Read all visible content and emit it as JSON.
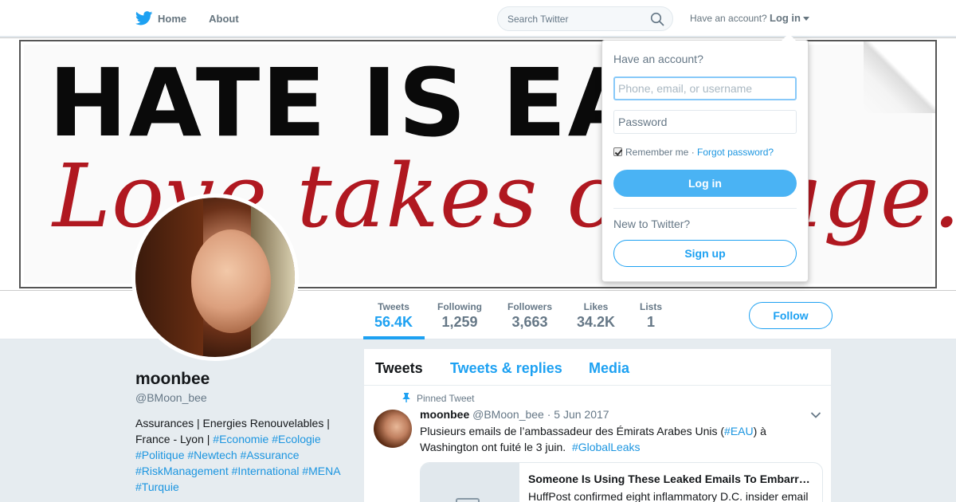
{
  "nav": {
    "home_label": "Home",
    "about_label": "About",
    "search_placeholder": "Search Twitter",
    "have_account": "Have an account?",
    "login_label": "Log in"
  },
  "banner": {
    "line1": "HATE IS EASY",
    "line2": "Love takes courage."
  },
  "profile": {
    "name": "moonbee",
    "handle": "@BMoon_bee",
    "bio_text": "Assurances | Energies Renouvelables | France - Lyon |",
    "bio_tags": [
      "#Economie",
      "#Ecologie",
      "#Politique",
      "#Newtech",
      "#Assurance",
      "#RiskManagement",
      "#International",
      "#MENA",
      "#Turquie"
    ]
  },
  "stats": [
    {
      "label": "Tweets",
      "value": "56.4K"
    },
    {
      "label": "Following",
      "value": "1,259"
    },
    {
      "label": "Followers",
      "value": "3,663"
    },
    {
      "label": "Likes",
      "value": "34.2K"
    },
    {
      "label": "Lists",
      "value": "1"
    }
  ],
  "follow_label": "Follow",
  "timeline": {
    "tabs": [
      "Tweets",
      "Tweets & replies",
      "Media"
    ],
    "pinned_label": "Pinned Tweet",
    "tweet": {
      "name": "moonbee",
      "handle": "@BMoon_bee",
      "dot": "·",
      "date": "5 Jun 2017",
      "text_before": "Plusieurs emails de l’ambassadeur des Émirats Arabes Unis (",
      "tag1": "#EAU",
      "text_mid": ") à Washington ont fuité le 3 juin.",
      "tag2": "#GlobalLeaks",
      "card_title": "Someone Is Using These Leaked Emails To Embarrass Washington's Most Powerful Ambassador",
      "card_desc": "HuffPost confirmed eight inflammatory D.C. insider email"
    }
  },
  "login_dropdown": {
    "title": "Have an account?",
    "username_placeholder": "Phone, email, or username",
    "password_placeholder": "Password",
    "remember": "Remember me",
    "separator": "·",
    "forgot": "Forgot password?",
    "login_button": "Log in",
    "new_label": "New to Twitter?",
    "signup_button": "Sign up"
  },
  "colors": {
    "accent": "#1da1f2",
    "login_button_bg": "#4ab3f4",
    "page_bg": "#e6ecf0",
    "banner_red": "#b01820"
  }
}
